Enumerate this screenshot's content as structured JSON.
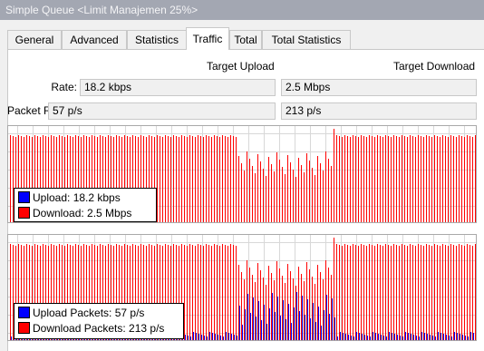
{
  "window": {
    "title": "Simple Queue <Limit Manajemen 25%>"
  },
  "tabs": [
    {
      "label": "General"
    },
    {
      "label": "Advanced"
    },
    {
      "label": "Statistics"
    },
    {
      "label": "Traffic",
      "active": true
    },
    {
      "label": "Total"
    },
    {
      "label": "Total Statistics"
    }
  ],
  "traffic": {
    "target_upload_header": "Target Upload",
    "target_download_header": "Target Download",
    "rate_label": "Rate:",
    "rate_upload": "18.2 kbps",
    "rate_download": "2.5 Mbps",
    "packet_rate_label": "Packet Rate:",
    "packet_rate_upload": "57 p/s",
    "packet_rate_download": "213 p/s"
  },
  "graphs": {
    "colors": {
      "upload": "#0000ff",
      "download": "#ff0000",
      "grid": "#d8d8d8"
    },
    "rate_legend": {
      "upload": "Upload:  18.2 kbps",
      "download": "Download:  2.5 Mbps"
    },
    "packets_legend": {
      "upload": "Upload Packets:  57 p/s",
      "download": "Download Packets:  213 p/s"
    }
  }
}
